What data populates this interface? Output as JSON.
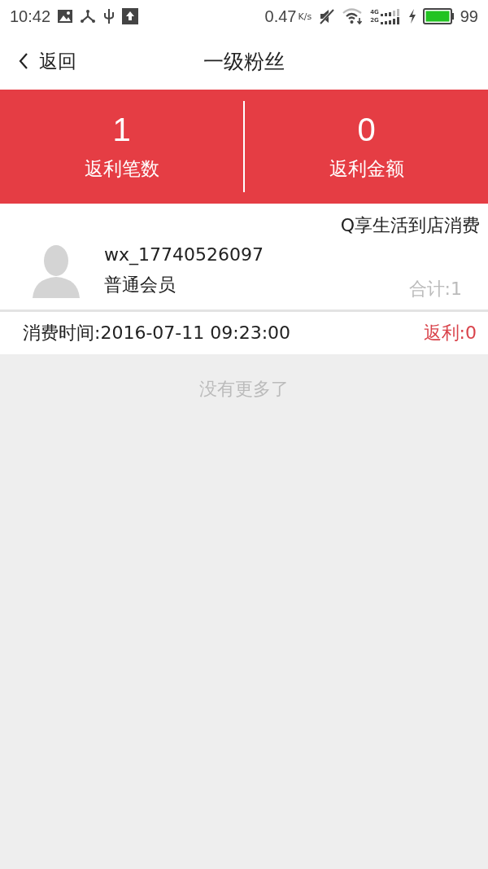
{
  "status_bar": {
    "time": "10:42",
    "speed": "0.47",
    "speed_unit": "K/s",
    "network_top": "4G",
    "network_bottom": "2G",
    "battery": "99"
  },
  "nav": {
    "back": "返回",
    "title": "一级粉丝"
  },
  "stats": [
    {
      "value": "1",
      "label": "返利笔数"
    },
    {
      "value": "0",
      "label": "返利金额"
    }
  ],
  "record": {
    "store": "Q享生活到店消费",
    "user": "wx_17740526097",
    "member_type": "普通会员",
    "total": "合计:1",
    "time": "消费时间:2016-07-11 09:23:00",
    "rebate": "返利:0"
  },
  "footer": "没有更多了"
}
